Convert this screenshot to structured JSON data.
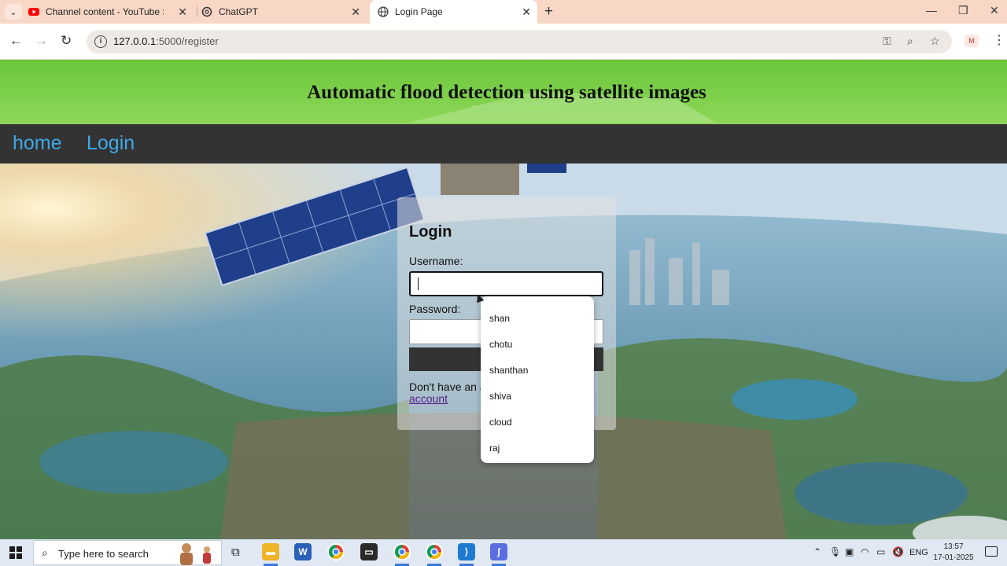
{
  "browser": {
    "tabs": [
      {
        "title": "Channel content - YouTube Stu",
        "icon": "youtube-icon",
        "active": false
      },
      {
        "title": "ChatGPT",
        "icon": "chatgpt-icon",
        "active": false
      },
      {
        "title": "Login Page",
        "icon": "globe-icon",
        "active": true
      }
    ],
    "url_host": "127.0.0.1",
    "url_path": ":5000/register"
  },
  "page": {
    "banner_title": "Automatic flood detection using satellite images",
    "nav": [
      {
        "label": "home"
      },
      {
        "label": "Login"
      }
    ],
    "login": {
      "heading": "Login",
      "username_label": "Username:",
      "password_label": "Password:",
      "footer_text": "Don't have an a",
      "footer_link": "account"
    },
    "autocomplete": [
      "shan",
      "chotu",
      "shanthan",
      "shiva",
      "cloud",
      "raj"
    ]
  },
  "taskbar": {
    "search_placeholder": "Type here to search",
    "language": "ENG",
    "time": "13:57",
    "date": "17-01-2025"
  },
  "colors": {
    "banner_green": "#7fd14c",
    "nav_bg": "#333333",
    "nav_link": "#3fa9e8",
    "tabstrip": "#f9d7c6"
  }
}
